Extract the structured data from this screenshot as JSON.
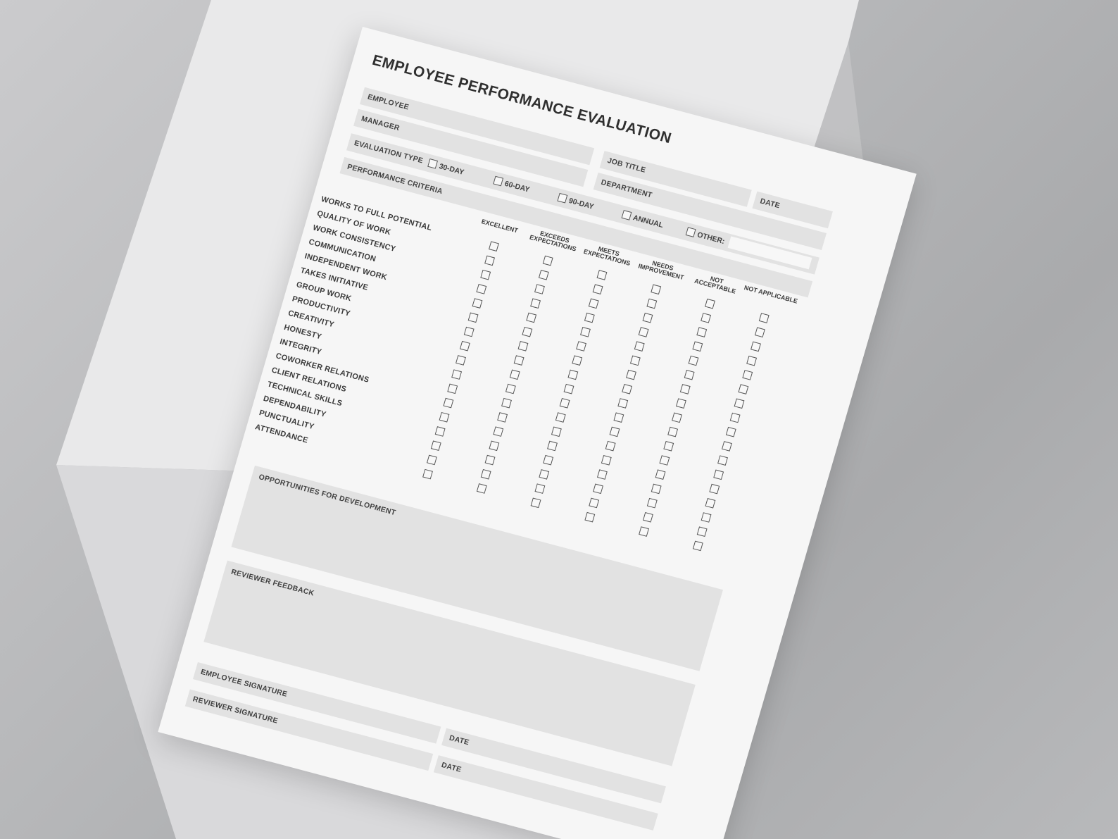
{
  "form": {
    "title": "EMPLOYEE PERFORMANCE EVALUATION",
    "employee_label": "EMPLOYEE",
    "manager_label": "MANAGER",
    "job_title_label": "JOB TITLE",
    "date_label": "DATE",
    "department_label": "DEPARTMENT",
    "evaluation_type_label": "EVALUATION TYPE",
    "evaluation_types": [
      "30-DAY",
      "60-DAY",
      "90-DAY",
      "ANNUAL",
      "OTHER:"
    ],
    "performance_criteria_label": "PERFORMANCE CRITERIA",
    "rating_columns": [
      "EXCELLENT",
      "EXCEEDS EXPECTATIONS",
      "MEETS EXPECTATIONS",
      "NEEDS IMPROVEMENT",
      "NOT ACCEPTABLE",
      "NOT APPLICABLE"
    ],
    "criteria": [
      "WORKS TO FULL POTENTIAL",
      "QUALITY OF WORK",
      "WORK CONSISTENCY",
      "COMMUNICATION",
      "INDEPENDENT WORK",
      "TAKES INITIATIVE",
      "GROUP WORK",
      "PRODUCTIVITY",
      "CREATIVITY",
      "HONESTY",
      "INTEGRITY",
      "COWORKER RELATIONS",
      "CLIENT RELATIONS",
      "TECHNICAL SKILLS",
      "DEPENDABILITY",
      "PUNCTUALITY",
      "ATTENDANCE"
    ],
    "opportunities_label": "OPPORTUNITIES FOR DEVELOPMENT",
    "reviewer_feedback_label": "REVIEWER FEEDBACK",
    "employee_signature_label": "EMPLOYEE SIGNATURE",
    "reviewer_signature_label": "REVIEWER SIGNATURE",
    "signature_date_label": "DATE"
  },
  "colors": {
    "paper": "#f6f6f6",
    "field": "#e2e2e2",
    "text": "#3a3a3a",
    "background": "#b5b6b8"
  }
}
